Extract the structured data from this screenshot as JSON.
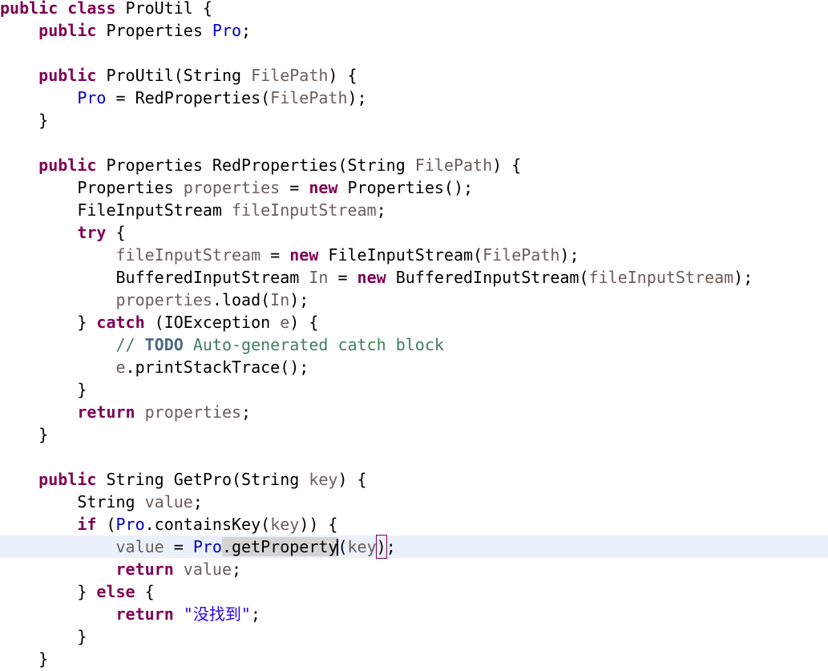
{
  "editor": {
    "language": "java",
    "file_name": "ProUtil.java",
    "font_size_px": 20,
    "line_height_px": 28,
    "colors": {
      "background": "#ffffff",
      "foreground": "#000000",
      "keyword": "#7f0055",
      "field": "#0000c0",
      "local_variable": "#6a5f5a",
      "string": "#2a00ff",
      "comment": "#3f7f5f",
      "todo_tag": "#4a6a8a",
      "current_line_highlight": "#eaf1fb",
      "occurrence_highlight": "#d4d4d4",
      "bracket_match_outline": "#7f0055"
    },
    "caret": {
      "line_index": 24,
      "after_token": "getProperty"
    }
  },
  "code_lines": [
    {
      "index": 0,
      "current": false,
      "tokens": [
        {
          "t": "public",
          "c": "kw"
        },
        {
          "t": " ",
          "c": "plain"
        },
        {
          "t": "class",
          "c": "kw"
        },
        {
          "t": " ProUtil {",
          "c": "plain"
        }
      ]
    },
    {
      "index": 1,
      "current": false,
      "tokens": [
        {
          "t": "    ",
          "c": "plain"
        },
        {
          "t": "public",
          "c": "kw"
        },
        {
          "t": " Properties ",
          "c": "plain"
        },
        {
          "t": "Pro",
          "c": "field"
        },
        {
          "t": ";",
          "c": "plain"
        }
      ]
    },
    {
      "index": 2,
      "current": false,
      "tokens": [
        {
          "t": "",
          "c": "plain"
        }
      ]
    },
    {
      "index": 3,
      "current": false,
      "tokens": [
        {
          "t": "    ",
          "c": "plain"
        },
        {
          "t": "public",
          "c": "kw"
        },
        {
          "t": " ProUtil(String ",
          "c": "plain"
        },
        {
          "t": "FilePath",
          "c": "local"
        },
        {
          "t": ") {",
          "c": "plain"
        }
      ]
    },
    {
      "index": 4,
      "current": false,
      "tokens": [
        {
          "t": "        ",
          "c": "plain"
        },
        {
          "t": "Pro",
          "c": "field"
        },
        {
          "t": " = RedProperties(",
          "c": "plain"
        },
        {
          "t": "FilePath",
          "c": "local"
        },
        {
          "t": ");",
          "c": "plain"
        }
      ]
    },
    {
      "index": 5,
      "current": false,
      "tokens": [
        {
          "t": "    }",
          "c": "plain"
        }
      ]
    },
    {
      "index": 6,
      "current": false,
      "tokens": [
        {
          "t": "",
          "c": "plain"
        }
      ]
    },
    {
      "index": 7,
      "current": false,
      "tokens": [
        {
          "t": "    ",
          "c": "plain"
        },
        {
          "t": "public",
          "c": "kw"
        },
        {
          "t": " Properties RedProperties(String ",
          "c": "plain"
        },
        {
          "t": "FilePath",
          "c": "local"
        },
        {
          "t": ") {",
          "c": "plain"
        }
      ]
    },
    {
      "index": 8,
      "current": false,
      "tokens": [
        {
          "t": "        Properties ",
          "c": "plain"
        },
        {
          "t": "properties",
          "c": "local"
        },
        {
          "t": " = ",
          "c": "plain"
        },
        {
          "t": "new",
          "c": "kw"
        },
        {
          "t": " Properties();",
          "c": "plain"
        }
      ]
    },
    {
      "index": 9,
      "current": false,
      "tokens": [
        {
          "t": "        FileInputStream ",
          "c": "plain"
        },
        {
          "t": "fileInputStream",
          "c": "local"
        },
        {
          "t": ";",
          "c": "plain"
        }
      ]
    },
    {
      "index": 10,
      "current": false,
      "tokens": [
        {
          "t": "        ",
          "c": "plain"
        },
        {
          "t": "try",
          "c": "kw"
        },
        {
          "t": " {",
          "c": "plain"
        }
      ]
    },
    {
      "index": 11,
      "current": false,
      "tokens": [
        {
          "t": "            ",
          "c": "plain"
        },
        {
          "t": "fileInputStream",
          "c": "local"
        },
        {
          "t": " = ",
          "c": "plain"
        },
        {
          "t": "new",
          "c": "kw"
        },
        {
          "t": " FileInputStream(",
          "c": "plain"
        },
        {
          "t": "FilePath",
          "c": "local"
        },
        {
          "t": ");",
          "c": "plain"
        }
      ]
    },
    {
      "index": 12,
      "current": false,
      "tokens": [
        {
          "t": "            BufferedInputStream ",
          "c": "plain"
        },
        {
          "t": "In",
          "c": "local"
        },
        {
          "t": " = ",
          "c": "plain"
        },
        {
          "t": "new",
          "c": "kw"
        },
        {
          "t": " BufferedInputStream(",
          "c": "plain"
        },
        {
          "t": "fileInputStream",
          "c": "local"
        },
        {
          "t": ");",
          "c": "plain"
        }
      ]
    },
    {
      "index": 13,
      "current": false,
      "tokens": [
        {
          "t": "            ",
          "c": "plain"
        },
        {
          "t": "properties",
          "c": "local"
        },
        {
          "t": ".load(",
          "c": "plain"
        },
        {
          "t": "In",
          "c": "local"
        },
        {
          "t": ");",
          "c": "plain"
        }
      ]
    },
    {
      "index": 14,
      "current": false,
      "tokens": [
        {
          "t": "        } ",
          "c": "plain"
        },
        {
          "t": "catch",
          "c": "kw"
        },
        {
          "t": " (IOException ",
          "c": "plain"
        },
        {
          "t": "e",
          "c": "local"
        },
        {
          "t": ") {",
          "c": "plain"
        }
      ]
    },
    {
      "index": 15,
      "current": false,
      "tokens": [
        {
          "t": "            ",
          "c": "plain"
        },
        {
          "t": "// ",
          "c": "cmt"
        },
        {
          "t": "TODO",
          "c": "todo"
        },
        {
          "t": " Auto-generated catch block",
          "c": "cmt"
        }
      ]
    },
    {
      "index": 16,
      "current": false,
      "tokens": [
        {
          "t": "            ",
          "c": "plain"
        },
        {
          "t": "e",
          "c": "local"
        },
        {
          "t": ".printStackTrace();",
          "c": "plain"
        }
      ]
    },
    {
      "index": 17,
      "current": false,
      "tokens": [
        {
          "t": "        }",
          "c": "plain"
        }
      ]
    },
    {
      "index": 18,
      "current": false,
      "tokens": [
        {
          "t": "        ",
          "c": "plain"
        },
        {
          "t": "return",
          "c": "kw"
        },
        {
          "t": " ",
          "c": "plain"
        },
        {
          "t": "properties",
          "c": "local"
        },
        {
          "t": ";",
          "c": "plain"
        }
      ]
    },
    {
      "index": 19,
      "current": false,
      "tokens": [
        {
          "t": "    }",
          "c": "plain"
        }
      ]
    },
    {
      "index": 20,
      "current": false,
      "tokens": [
        {
          "t": "",
          "c": "plain"
        }
      ]
    },
    {
      "index": 21,
      "current": false,
      "tokens": [
        {
          "t": "    ",
          "c": "plain"
        },
        {
          "t": "public",
          "c": "kw"
        },
        {
          "t": " String GetPro(String ",
          "c": "plain"
        },
        {
          "t": "key",
          "c": "local"
        },
        {
          "t": ") {",
          "c": "plain"
        }
      ]
    },
    {
      "index": 22,
      "current": false,
      "tokens": [
        {
          "t": "        String ",
          "c": "plain"
        },
        {
          "t": "value",
          "c": "local"
        },
        {
          "t": ";",
          "c": "plain"
        }
      ]
    },
    {
      "index": 23,
      "current": false,
      "tokens": [
        {
          "t": "        ",
          "c": "plain"
        },
        {
          "t": "if",
          "c": "kw"
        },
        {
          "t": " (",
          "c": "plain"
        },
        {
          "t": "Pro",
          "c": "field"
        },
        {
          "t": ".containsKey(",
          "c": "plain"
        },
        {
          "t": "key",
          "c": "local"
        },
        {
          "t": ")) {",
          "c": "plain"
        }
      ]
    },
    {
      "index": 24,
      "current": true,
      "tokens": [
        {
          "t": "            ",
          "c": "plain"
        },
        {
          "t": "value",
          "c": "local"
        },
        {
          "t": " = ",
          "c": "plain"
        },
        {
          "t": "Pro",
          "c": "field"
        },
        {
          "t": ".getProperty",
          "c": "plain",
          "occurrence": true
        },
        {
          "t": "",
          "c": "caret"
        },
        {
          "t": "(",
          "c": "plain"
        },
        {
          "t": "key",
          "c": "local"
        },
        {
          "t": ")",
          "c": "plain",
          "bracket_match": true
        },
        {
          "t": ";",
          "c": "plain"
        }
      ]
    },
    {
      "index": 25,
      "current": false,
      "tokens": [
        {
          "t": "            ",
          "c": "plain"
        },
        {
          "t": "return",
          "c": "kw"
        },
        {
          "t": " ",
          "c": "plain"
        },
        {
          "t": "value",
          "c": "local"
        },
        {
          "t": ";",
          "c": "plain"
        }
      ]
    },
    {
      "index": 26,
      "current": false,
      "tokens": [
        {
          "t": "        } ",
          "c": "plain"
        },
        {
          "t": "else",
          "c": "kw"
        },
        {
          "t": " {",
          "c": "plain"
        }
      ]
    },
    {
      "index": 27,
      "current": false,
      "tokens": [
        {
          "t": "            ",
          "c": "plain"
        },
        {
          "t": "return",
          "c": "kw"
        },
        {
          "t": " ",
          "c": "plain"
        },
        {
          "t": "\"没找到\"",
          "c": "str"
        },
        {
          "t": ";",
          "c": "plain"
        }
      ]
    },
    {
      "index": 28,
      "current": false,
      "tokens": [
        {
          "t": "        }",
          "c": "plain"
        }
      ]
    },
    {
      "index": 29,
      "current": false,
      "tokens": [
        {
          "t": "    }",
          "c": "plain"
        }
      ]
    }
  ]
}
